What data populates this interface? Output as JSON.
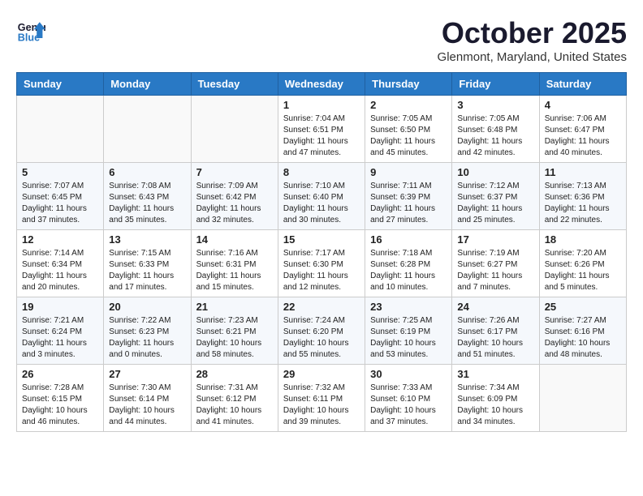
{
  "logo": {
    "line1": "General",
    "line2": "Blue"
  },
  "title": "October 2025",
  "location": "Glenmont, Maryland, United States",
  "weekdays": [
    "Sunday",
    "Monday",
    "Tuesday",
    "Wednesday",
    "Thursday",
    "Friday",
    "Saturday"
  ],
  "weeks": [
    [
      {
        "day": "",
        "info": ""
      },
      {
        "day": "",
        "info": ""
      },
      {
        "day": "",
        "info": ""
      },
      {
        "day": "1",
        "info": "Sunrise: 7:04 AM\nSunset: 6:51 PM\nDaylight: 11 hours\nand 47 minutes."
      },
      {
        "day": "2",
        "info": "Sunrise: 7:05 AM\nSunset: 6:50 PM\nDaylight: 11 hours\nand 45 minutes."
      },
      {
        "day": "3",
        "info": "Sunrise: 7:05 AM\nSunset: 6:48 PM\nDaylight: 11 hours\nand 42 minutes."
      },
      {
        "day": "4",
        "info": "Sunrise: 7:06 AM\nSunset: 6:47 PM\nDaylight: 11 hours\nand 40 minutes."
      }
    ],
    [
      {
        "day": "5",
        "info": "Sunrise: 7:07 AM\nSunset: 6:45 PM\nDaylight: 11 hours\nand 37 minutes."
      },
      {
        "day": "6",
        "info": "Sunrise: 7:08 AM\nSunset: 6:43 PM\nDaylight: 11 hours\nand 35 minutes."
      },
      {
        "day": "7",
        "info": "Sunrise: 7:09 AM\nSunset: 6:42 PM\nDaylight: 11 hours\nand 32 minutes."
      },
      {
        "day": "8",
        "info": "Sunrise: 7:10 AM\nSunset: 6:40 PM\nDaylight: 11 hours\nand 30 minutes."
      },
      {
        "day": "9",
        "info": "Sunrise: 7:11 AM\nSunset: 6:39 PM\nDaylight: 11 hours\nand 27 minutes."
      },
      {
        "day": "10",
        "info": "Sunrise: 7:12 AM\nSunset: 6:37 PM\nDaylight: 11 hours\nand 25 minutes."
      },
      {
        "day": "11",
        "info": "Sunrise: 7:13 AM\nSunset: 6:36 PM\nDaylight: 11 hours\nand 22 minutes."
      }
    ],
    [
      {
        "day": "12",
        "info": "Sunrise: 7:14 AM\nSunset: 6:34 PM\nDaylight: 11 hours\nand 20 minutes."
      },
      {
        "day": "13",
        "info": "Sunrise: 7:15 AM\nSunset: 6:33 PM\nDaylight: 11 hours\nand 17 minutes."
      },
      {
        "day": "14",
        "info": "Sunrise: 7:16 AM\nSunset: 6:31 PM\nDaylight: 11 hours\nand 15 minutes."
      },
      {
        "day": "15",
        "info": "Sunrise: 7:17 AM\nSunset: 6:30 PM\nDaylight: 11 hours\nand 12 minutes."
      },
      {
        "day": "16",
        "info": "Sunrise: 7:18 AM\nSunset: 6:28 PM\nDaylight: 11 hours\nand 10 minutes."
      },
      {
        "day": "17",
        "info": "Sunrise: 7:19 AM\nSunset: 6:27 PM\nDaylight: 11 hours\nand 7 minutes."
      },
      {
        "day": "18",
        "info": "Sunrise: 7:20 AM\nSunset: 6:26 PM\nDaylight: 11 hours\nand 5 minutes."
      }
    ],
    [
      {
        "day": "19",
        "info": "Sunrise: 7:21 AM\nSunset: 6:24 PM\nDaylight: 11 hours\nand 3 minutes."
      },
      {
        "day": "20",
        "info": "Sunrise: 7:22 AM\nSunset: 6:23 PM\nDaylight: 11 hours\nand 0 minutes."
      },
      {
        "day": "21",
        "info": "Sunrise: 7:23 AM\nSunset: 6:21 PM\nDaylight: 10 hours\nand 58 minutes."
      },
      {
        "day": "22",
        "info": "Sunrise: 7:24 AM\nSunset: 6:20 PM\nDaylight: 10 hours\nand 55 minutes."
      },
      {
        "day": "23",
        "info": "Sunrise: 7:25 AM\nSunset: 6:19 PM\nDaylight: 10 hours\nand 53 minutes."
      },
      {
        "day": "24",
        "info": "Sunrise: 7:26 AM\nSunset: 6:17 PM\nDaylight: 10 hours\nand 51 minutes."
      },
      {
        "day": "25",
        "info": "Sunrise: 7:27 AM\nSunset: 6:16 PM\nDaylight: 10 hours\nand 48 minutes."
      }
    ],
    [
      {
        "day": "26",
        "info": "Sunrise: 7:28 AM\nSunset: 6:15 PM\nDaylight: 10 hours\nand 46 minutes."
      },
      {
        "day": "27",
        "info": "Sunrise: 7:30 AM\nSunset: 6:14 PM\nDaylight: 10 hours\nand 44 minutes."
      },
      {
        "day": "28",
        "info": "Sunrise: 7:31 AM\nSunset: 6:12 PM\nDaylight: 10 hours\nand 41 minutes."
      },
      {
        "day": "29",
        "info": "Sunrise: 7:32 AM\nSunset: 6:11 PM\nDaylight: 10 hours\nand 39 minutes."
      },
      {
        "day": "30",
        "info": "Sunrise: 7:33 AM\nSunset: 6:10 PM\nDaylight: 10 hours\nand 37 minutes."
      },
      {
        "day": "31",
        "info": "Sunrise: 7:34 AM\nSunset: 6:09 PM\nDaylight: 10 hours\nand 34 minutes."
      },
      {
        "day": "",
        "info": ""
      }
    ]
  ]
}
